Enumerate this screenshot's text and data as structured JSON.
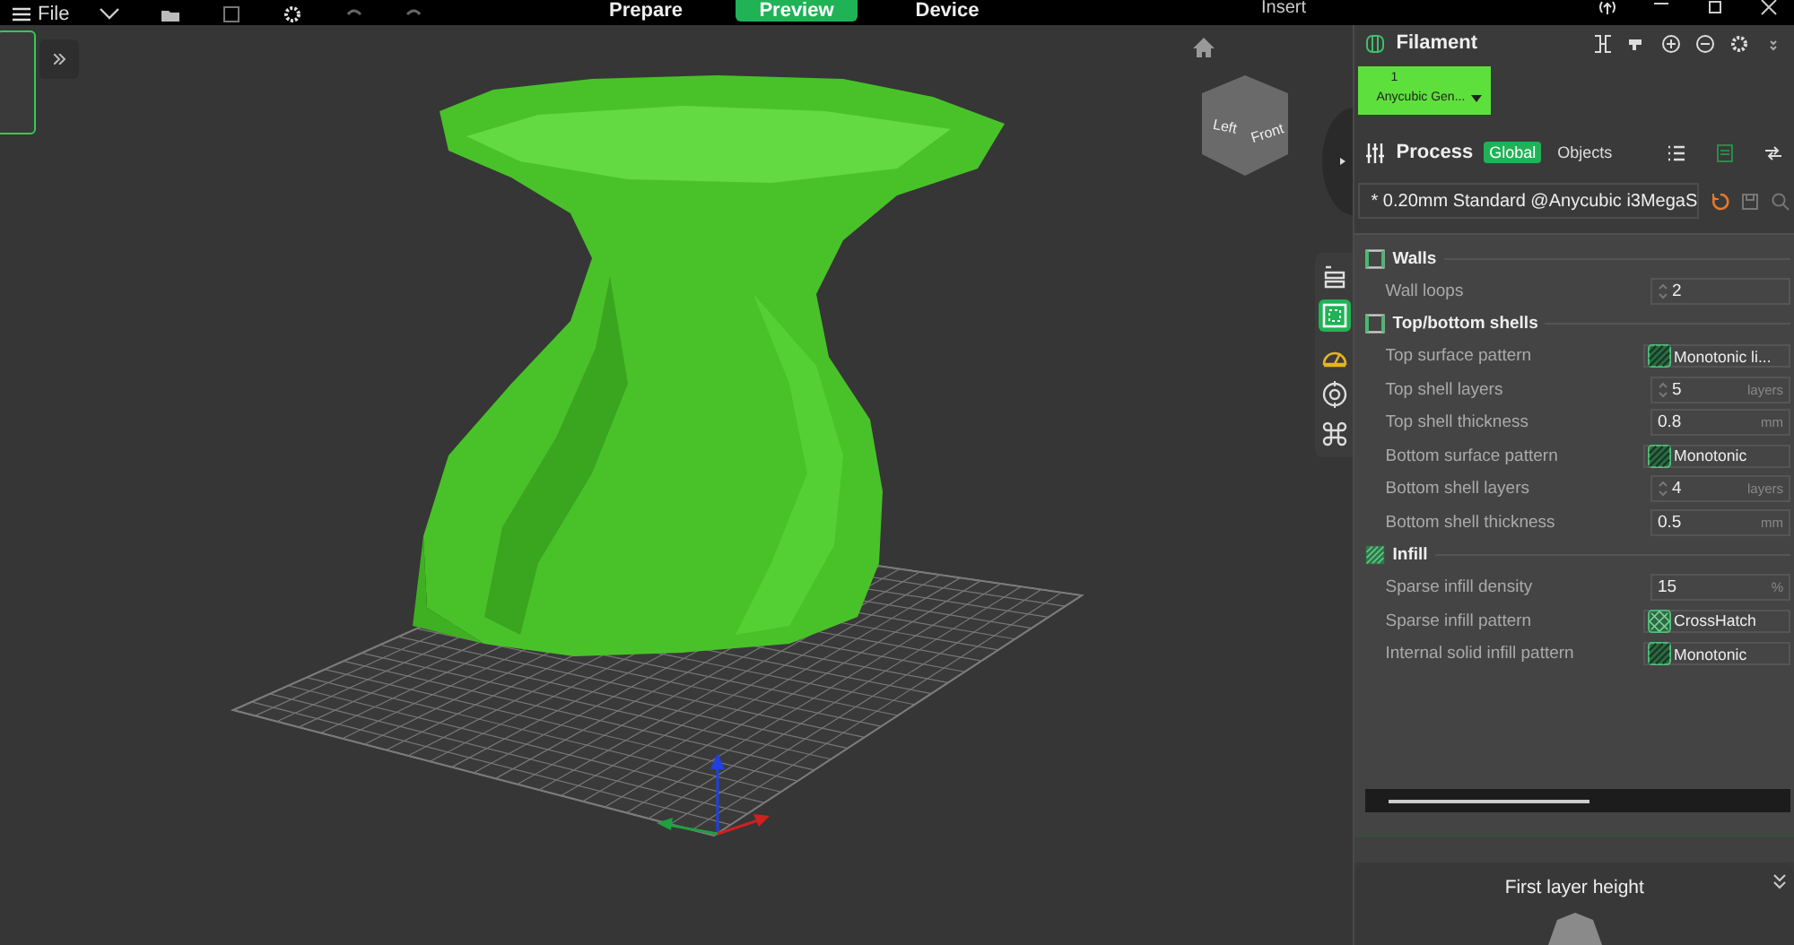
{
  "toolbar": {
    "menu": "File",
    "tabs": [
      {
        "label": "Prepare",
        "selected": false
      },
      {
        "label": "Preview",
        "selected": true
      },
      {
        "label": "Device",
        "selected": false
      }
    ],
    "insert": "Insert"
  },
  "view_cube": {
    "faces": [
      "Left",
      "Front"
    ]
  },
  "filament": {
    "title": "Filament",
    "slots": [
      {
        "number": "1",
        "name": "Anycubic Gen...",
        "color": "#5ee03c"
      }
    ]
  },
  "process": {
    "title": "Process",
    "tabs": [
      {
        "label": "Global",
        "selected": true
      },
      {
        "label": "Objects",
        "selected": false
      }
    ],
    "preset": "* 0.20mm Standard @Anycubic i3MegaS"
  },
  "category_tabs": [
    {
      "kind": "quality",
      "selected": false
    },
    {
      "kind": "strength",
      "selected": true
    },
    {
      "kind": "speed",
      "selected": false
    },
    {
      "kind": "support",
      "selected": false
    },
    {
      "kind": "others",
      "selected": false
    }
  ],
  "sections": [
    {
      "title": "Walls",
      "kind": "walls",
      "settings": [
        {
          "label": "Wall loops",
          "kind": "spin",
          "value": "2"
        }
      ]
    },
    {
      "title": "Top/bottom shells",
      "kind": "walls",
      "settings": [
        {
          "label": "Top surface pattern",
          "kind": "lines",
          "value": "Monotonic li..."
        },
        {
          "label": "Top shell layers",
          "kind": "spin",
          "value": "5",
          "unit": "layers"
        },
        {
          "label": "Top shell thickness",
          "kind": "input",
          "value": "0.8",
          "unit": "mm"
        },
        {
          "label": "Bottom surface pattern",
          "kind": "lines",
          "value": "Monotonic"
        },
        {
          "label": "Bottom shell layers",
          "kind": "spin",
          "value": "4",
          "unit": "layers"
        },
        {
          "label": "Bottom shell thickness",
          "kind": "input",
          "value": "0.5",
          "unit": "mm"
        }
      ]
    },
    {
      "title": "Infill",
      "kind": "infill",
      "settings": [
        {
          "label": "Sparse infill density",
          "kind": "input",
          "value": "15",
          "unit": "%"
        },
        {
          "label": "Sparse infill pattern",
          "kind": "crosshatch",
          "value": "CrossHatch"
        },
        {
          "label": "Internal solid infill pattern",
          "kind": "lines",
          "value": "Monotonic"
        }
      ]
    }
  ],
  "bottom_panel": {
    "title": "First layer height"
  }
}
